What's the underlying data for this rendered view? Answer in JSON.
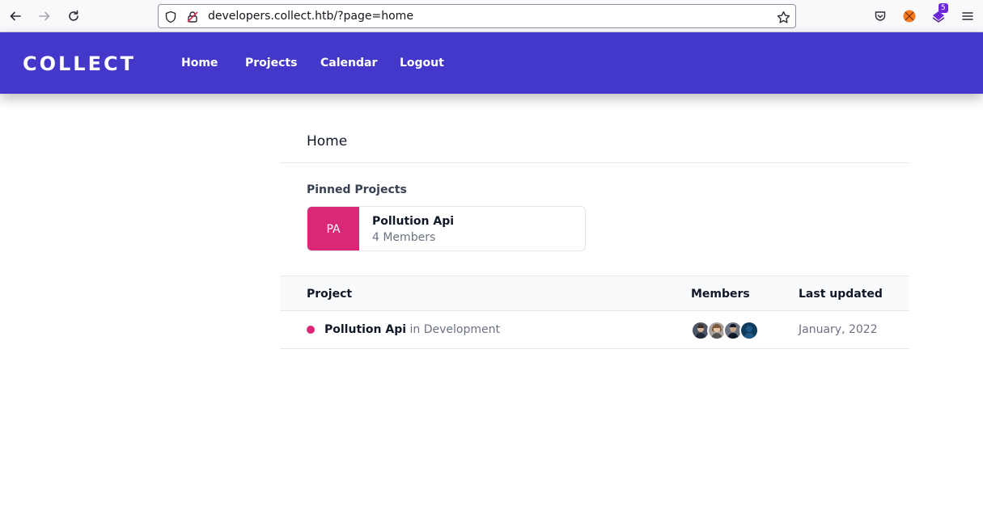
{
  "browser": {
    "url": "developers.collect.htb/?page=home",
    "extension_badge": "5"
  },
  "app": {
    "brand": "COLLECT",
    "nav": [
      {
        "label": "Home"
      },
      {
        "label": "Projects"
      },
      {
        "label": "Calendar"
      },
      {
        "label": "Logout"
      }
    ]
  },
  "main": {
    "title": "Home",
    "pinned_label": "Pinned Projects",
    "pinned": {
      "initials": "PA",
      "name": "Pollution Api",
      "members": "4 Members",
      "color": "#db2777"
    },
    "table": {
      "headers": [
        "Project",
        "Members",
        "Last updated"
      ],
      "rows": [
        {
          "name": "Pollution Api",
          "status": "in Development",
          "status_color": "#db2777",
          "member_count": 4,
          "last_updated": "January, 2022"
        }
      ]
    }
  },
  "colors": {
    "header_bg": "#4338ca",
    "accent": "#db2777"
  }
}
